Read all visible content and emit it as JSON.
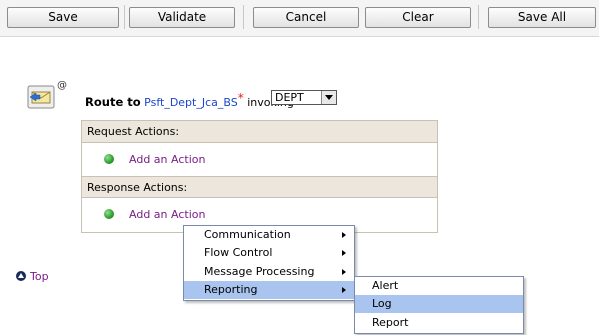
{
  "toolbar": {
    "buttons": [
      "Save",
      "Validate",
      "Cancel",
      "Clear",
      "Save All"
    ]
  },
  "route": {
    "label": "Route to",
    "service": "Psft_Dept_Jca_BS",
    "required_mark": "*",
    "invoking_label": "invoking",
    "operation": "DEPT"
  },
  "actions": {
    "request_header": "Request Actions:",
    "response_header": "Response Actions:",
    "add_label": "Add an Action"
  },
  "top_link": "Top",
  "context_menu": {
    "items": [
      "Communication",
      "Flow Control",
      "Message Processing",
      "Reporting"
    ],
    "highlighted": "Reporting"
  },
  "submenu": {
    "items": [
      "Alert",
      "Log",
      "Report"
    ],
    "highlighted": "Log"
  },
  "colors": {
    "link": "#7a1e87",
    "service_link": "#1a46c8",
    "section_header": "#ece6dc",
    "menu_highlight": "#a9c4ee"
  }
}
